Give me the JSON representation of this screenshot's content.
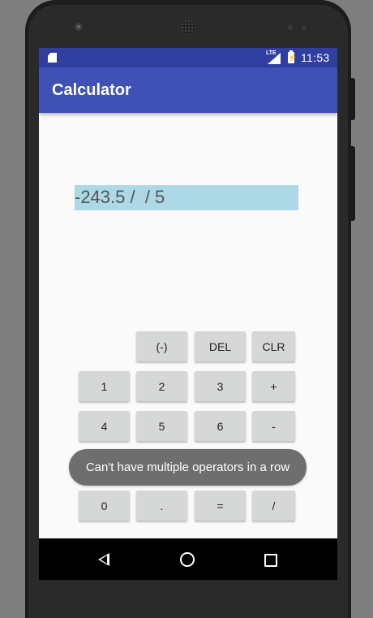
{
  "status_bar": {
    "time": "11:53",
    "network": "LTE",
    "icons": [
      "sd-card-icon",
      "signal-icon",
      "battery-charging-icon"
    ]
  },
  "app_bar": {
    "title": "Calculator"
  },
  "display": {
    "value": "-243.5 /  / 5"
  },
  "keypad": {
    "negate": "(-)",
    "delete": "DEL",
    "clear": "CLR",
    "one": "1",
    "two": "2",
    "three": "3",
    "plus": "+",
    "four": "4",
    "five": "5",
    "six": "6",
    "minus": "-",
    "zero": "0",
    "decimal": ".",
    "equals": "=",
    "divide": "/"
  },
  "toast": {
    "message": "Can't have multiple operators in a row"
  },
  "nav_bar": {
    "icons": [
      "back-icon",
      "home-icon",
      "recent-apps-icon"
    ]
  },
  "colors": {
    "status_bar": "#303f9f",
    "app_bar": "#3f51b5",
    "display_bg": "#add8e6",
    "key_bg": "#d6d7d7",
    "toast_bg": "#6e6e6e"
  }
}
